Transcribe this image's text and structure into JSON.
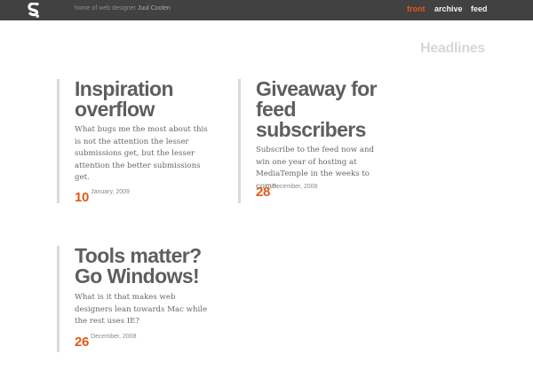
{
  "header": {
    "logo_icon": "s-logo-icon",
    "tagline_prefix": "home of web designer",
    "tagline_name": "Juul Coolen",
    "nav": [
      {
        "label": "front",
        "active": true
      },
      {
        "label": "archive",
        "active": false
      },
      {
        "label": "feed",
        "active": false
      }
    ]
  },
  "main": {
    "section_title": "Headlines",
    "posts": [
      {
        "title_line1": "Inspiration",
        "title_line2": "overflow",
        "excerpt": "What bugs me the most about this is not the attention the lesser submissions get, but the lesser attention the better submissions get.",
        "day": "10",
        "month_year": "January, 2009"
      },
      {
        "title_line1": "Giveaway for",
        "title_line2": "feed",
        "title_line3": "subscribers",
        "excerpt": "Subscribe to the feed now and win one year of hosting at MediaTemple in the weeks to come.",
        "day": "28",
        "month_year": "December, 2008"
      },
      {
        "title_line1": "Tools matter?",
        "title_line2": "Go Windows!",
        "excerpt": "What is it that makes web designers lean towards Mac while the rest uses IE?",
        "day": "26",
        "month_year": "December, 2008"
      }
    ]
  },
  "colors": {
    "topbar": "#404140",
    "accent": "#e15a17",
    "title": "#5e5e5e",
    "rule": "#dadada"
  }
}
